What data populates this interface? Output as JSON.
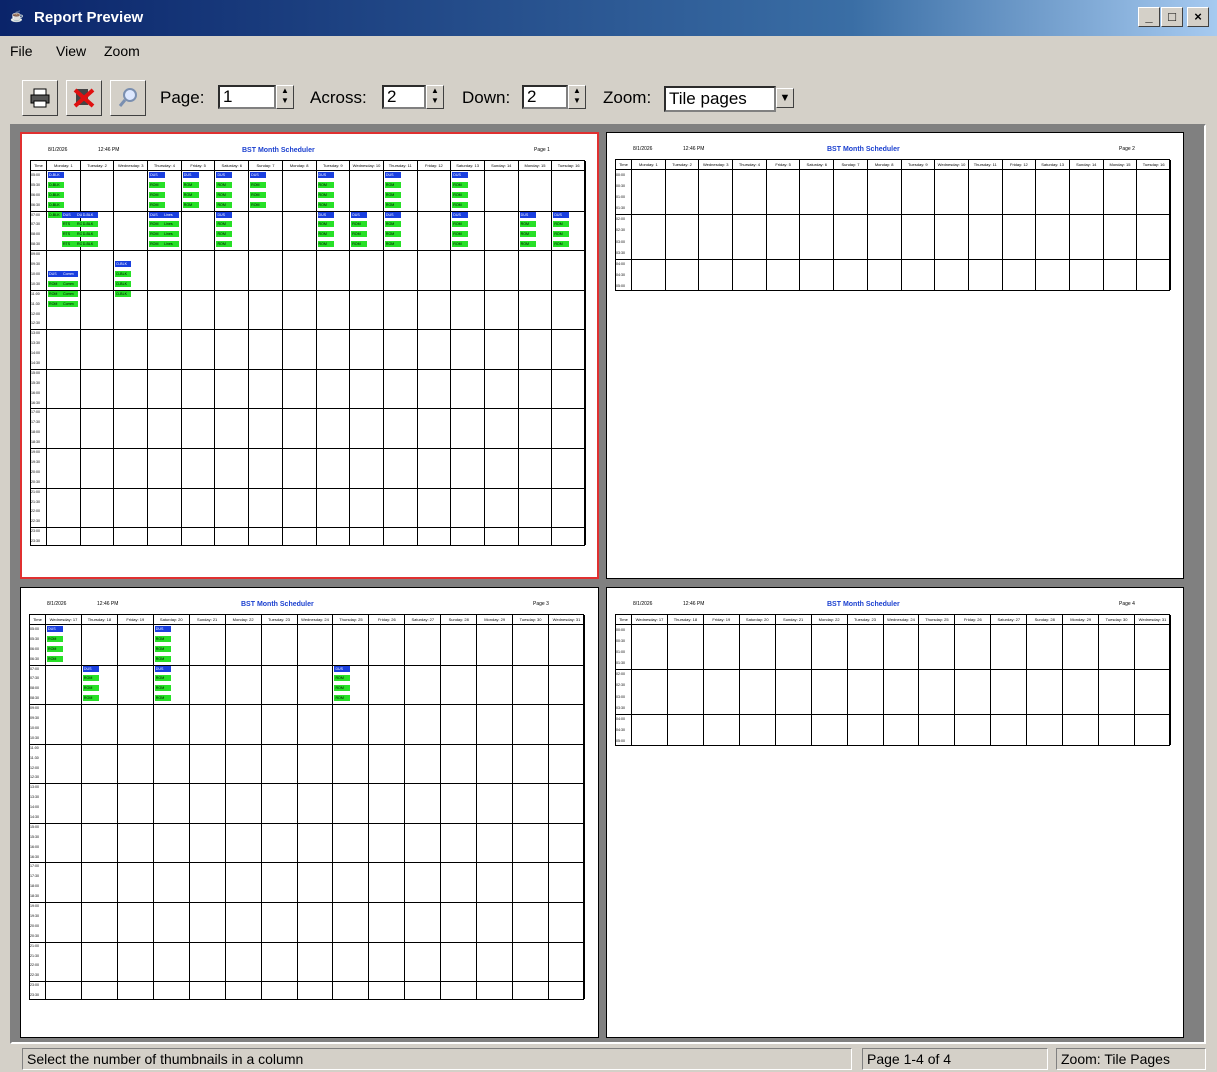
{
  "window": {
    "title": "Report Preview",
    "min_label": "_",
    "max_label": "□",
    "close_label": "×"
  },
  "menu": [
    "File",
    "View",
    "Zoom"
  ],
  "toolbar": {
    "page_label": "Page:",
    "page_value": "1",
    "across_label": "Across:",
    "across_value": "2",
    "down_label": "Down:",
    "down_value": "2",
    "zoom_label": "Zoom:",
    "zoom_value": "Tile pages",
    "icons": [
      "printer-icon",
      "close-x-icon",
      "magnifier-icon"
    ]
  },
  "pages": [
    {
      "date": "8/1/2026",
      "time": "12:46 PM",
      "title": "BST Month Scheduler",
      "page_label": "Page 1",
      "days": [
        "Time",
        "Monday: 1",
        "Tuesday: 2",
        "Wednesday: 3",
        "Thursday: 4",
        "Friday: 5",
        "Saturday: 6",
        "Sunday: 7",
        "Monday: 8",
        "Tuesday: 9",
        "Wednesday: 10",
        "Thursday: 11",
        "Friday: 12",
        "Saturday: 13",
        "Sunday: 14",
        "Monday: 15",
        "Tuesday: 16"
      ],
      "times": [
        "05:00",
        "05:30",
        "06:00",
        "06:30",
        "07:00",
        "07:30",
        "08:00",
        "08:30",
        "09:00",
        "09:30",
        "10:00",
        "10:30",
        "11:00",
        "11:30",
        "12:00",
        "12:30",
        "13:00",
        "13:30",
        "14:00",
        "14:30",
        "15:00",
        "15:30",
        "16:00",
        "16:30",
        "17:00",
        "17:30",
        "18:00",
        "18:30",
        "19:00",
        "19:30",
        "20:00",
        "20:30",
        "21:00",
        "21:30",
        "22:00",
        "22:30",
        "23:00",
        "23:30"
      ],
      "events": [
        {
          "col": 1,
          "row": 0,
          "text": "D-BLK",
          "c": "blue"
        },
        {
          "col": 1,
          "row": 1,
          "text": "D-BLK",
          "c": "green"
        },
        {
          "col": 1,
          "row": 2,
          "text": "D-BLK",
          "c": "green"
        },
        {
          "col": 1,
          "row": 3,
          "text": "D-BLK",
          "c": "green"
        },
        {
          "col": 1,
          "row": 4,
          "text": "D-BLK",
          "c": "green"
        },
        {
          "col": 4,
          "row": 0,
          "text": "DUS",
          "c": "blue"
        },
        {
          "col": 4,
          "row": 1,
          "text": "ROM",
          "c": "green"
        },
        {
          "col": 4,
          "row": 2,
          "text": "ROM",
          "c": "green"
        },
        {
          "col": 4,
          "row": 3,
          "text": "ROM",
          "c": "green"
        },
        {
          "col": 5,
          "row": 0,
          "text": "DUS",
          "c": "blue"
        },
        {
          "col": 5,
          "row": 1,
          "text": "ROM",
          "c": "green"
        },
        {
          "col": 5,
          "row": 2,
          "text": "ROM",
          "c": "green"
        },
        {
          "col": 5,
          "row": 3,
          "text": "ROM",
          "c": "green"
        },
        {
          "col": 6,
          "row": 0,
          "text": "DUS",
          "c": "blue"
        },
        {
          "col": 6,
          "row": 1,
          "text": "ROM",
          "c": "green"
        },
        {
          "col": 6,
          "row": 2,
          "text": "ROM",
          "c": "green"
        },
        {
          "col": 6,
          "row": 3,
          "text": "ROM",
          "c": "green"
        },
        {
          "col": 7,
          "row": 0,
          "text": "DUS",
          "c": "blue"
        },
        {
          "col": 7,
          "row": 1,
          "text": "ROM",
          "c": "green"
        },
        {
          "col": 7,
          "row": 2,
          "text": "ROM",
          "c": "green"
        },
        {
          "col": 7,
          "row": 3,
          "text": "ROM",
          "c": "green"
        },
        {
          "col": 9,
          "row": 0,
          "text": "DUS",
          "c": "blue"
        },
        {
          "col": 9,
          "row": 1,
          "text": "ROM",
          "c": "green"
        },
        {
          "col": 9,
          "row": 2,
          "text": "ROM",
          "c": "green"
        },
        {
          "col": 9,
          "row": 3,
          "text": "ROM",
          "c": "green"
        },
        {
          "col": 11,
          "row": 0,
          "text": "DUS",
          "c": "blue"
        },
        {
          "col": 11,
          "row": 1,
          "text": "ROM",
          "c": "green"
        },
        {
          "col": 11,
          "row": 2,
          "text": "ROM",
          "c": "green"
        },
        {
          "col": 11,
          "row": 3,
          "text": "ROM",
          "c": "green"
        },
        {
          "col": 13,
          "row": 0,
          "text": "DUS",
          "c": "blue"
        },
        {
          "col": 13,
          "row": 1,
          "text": "ROM",
          "c": "green"
        },
        {
          "col": 13,
          "row": 2,
          "text": "ROM",
          "c": "green"
        },
        {
          "col": 13,
          "row": 3,
          "text": "ROM",
          "c": "green"
        },
        {
          "col": 1,
          "row": 4,
          "text": "DUS",
          "c": "blue",
          "x": 14
        },
        {
          "col": 1,
          "row": 4,
          "text": "DUS",
          "c": "blue",
          "x": 28
        },
        {
          "col": 2,
          "row": 4,
          "text": "D-BLK",
          "c": "blue"
        },
        {
          "col": 1,
          "row": 5,
          "text": "RTS",
          "c": "green",
          "x": 14
        },
        {
          "col": 1,
          "row": 5,
          "text": "ROM",
          "c": "green",
          "x": 28
        },
        {
          "col": 2,
          "row": 5,
          "text": "D-BLK",
          "c": "green"
        },
        {
          "col": 1,
          "row": 6,
          "text": "RTS",
          "c": "green",
          "x": 14
        },
        {
          "col": 1,
          "row": 6,
          "text": "ROM",
          "c": "green",
          "x": 28
        },
        {
          "col": 2,
          "row": 6,
          "text": "D-BLK",
          "c": "green"
        },
        {
          "col": 1,
          "row": 7,
          "text": "RTS",
          "c": "green",
          "x": 14
        },
        {
          "col": 1,
          "row": 7,
          "text": "ROM",
          "c": "green",
          "x": 28
        },
        {
          "col": 2,
          "row": 7,
          "text": "D-BLK",
          "c": "green"
        },
        {
          "col": 4,
          "row": 4,
          "text": "DUS",
          "c": "blue"
        },
        {
          "col": 4,
          "row": 5,
          "text": "ROM",
          "c": "green"
        },
        {
          "col": 4,
          "row": 6,
          "text": "ROM",
          "c": "green"
        },
        {
          "col": 4,
          "row": 7,
          "text": "ROM",
          "c": "green"
        },
        {
          "col": 4,
          "row": 4,
          "text": "Lines",
          "c": "blue",
          "x": 14
        },
        {
          "col": 4,
          "row": 5,
          "text": "Lines",
          "c": "green",
          "x": 14
        },
        {
          "col": 4,
          "row": 6,
          "text": "Lines",
          "c": "green",
          "x": 14
        },
        {
          "col": 4,
          "row": 7,
          "text": "Lines",
          "c": "green",
          "x": 14
        },
        {
          "col": 6,
          "row": 4,
          "text": "DUS",
          "c": "blue"
        },
        {
          "col": 6,
          "row": 5,
          "text": "ROM",
          "c": "green"
        },
        {
          "col": 6,
          "row": 6,
          "text": "ROM",
          "c": "green"
        },
        {
          "col": 6,
          "row": 7,
          "text": "ROM",
          "c": "green"
        },
        {
          "col": 9,
          "row": 4,
          "text": "DUS",
          "c": "blue"
        },
        {
          "col": 9,
          "row": 5,
          "text": "ROM",
          "c": "green"
        },
        {
          "col": 9,
          "row": 6,
          "text": "ROM",
          "c": "green"
        },
        {
          "col": 9,
          "row": 7,
          "text": "ROM",
          "c": "green"
        },
        {
          "col": 10,
          "row": 4,
          "text": "DUS",
          "c": "blue"
        },
        {
          "col": 10,
          "row": 5,
          "text": "ROM",
          "c": "green"
        },
        {
          "col": 10,
          "row": 6,
          "text": "ROM",
          "c": "green"
        },
        {
          "col": 10,
          "row": 7,
          "text": "ROM",
          "c": "green"
        },
        {
          "col": 11,
          "row": 4,
          "text": "DUS",
          "c": "blue"
        },
        {
          "col": 11,
          "row": 5,
          "text": "ROM",
          "c": "green"
        },
        {
          "col": 11,
          "row": 6,
          "text": "ROM",
          "c": "green"
        },
        {
          "col": 11,
          "row": 7,
          "text": "ROM",
          "c": "green"
        },
        {
          "col": 13,
          "row": 4,
          "text": "DUS",
          "c": "blue"
        },
        {
          "col": 13,
          "row": 5,
          "text": "ROM",
          "c": "green"
        },
        {
          "col": 13,
          "row": 6,
          "text": "ROM",
          "c": "green"
        },
        {
          "col": 13,
          "row": 7,
          "text": "ROM",
          "c": "green"
        },
        {
          "col": 15,
          "row": 4,
          "text": "DUS",
          "c": "blue"
        },
        {
          "col": 15,
          "row": 5,
          "text": "ROM",
          "c": "green"
        },
        {
          "col": 15,
          "row": 6,
          "text": "ROM",
          "c": "green"
        },
        {
          "col": 15,
          "row": 7,
          "text": "ROM",
          "c": "green"
        },
        {
          "col": 16,
          "row": 4,
          "text": "DUS",
          "c": "blue"
        },
        {
          "col": 16,
          "row": 5,
          "text": "ROM",
          "c": "green"
        },
        {
          "col": 16,
          "row": 6,
          "text": "ROM",
          "c": "green"
        },
        {
          "col": 16,
          "row": 7,
          "text": "ROM",
          "c": "green"
        },
        {
          "col": 3,
          "row": 9,
          "text": "D-BLK",
          "c": "blue"
        },
        {
          "col": 3,
          "row": 10,
          "text": "D-BLK",
          "c": "green"
        },
        {
          "col": 3,
          "row": 11,
          "text": "D-BLK",
          "c": "green"
        },
        {
          "col": 3,
          "row": 12,
          "text": "D-BLK",
          "c": "green"
        },
        {
          "col": 1,
          "row": 10,
          "text": "DUS",
          "c": "blue"
        },
        {
          "col": 1,
          "row": 10,
          "text": "Comm",
          "c": "blue",
          "x": 14
        },
        {
          "col": 1,
          "row": 11,
          "text": "ROM",
          "c": "green"
        },
        {
          "col": 1,
          "row": 11,
          "text": "Comm",
          "c": "green",
          "x": 14
        },
        {
          "col": 1,
          "row": 12,
          "text": "ROM",
          "c": "green"
        },
        {
          "col": 1,
          "row": 12,
          "text": "Comm",
          "c": "green",
          "x": 14
        },
        {
          "col": 1,
          "row": 13,
          "text": "ROM",
          "c": "green"
        },
        {
          "col": 1,
          "row": 13,
          "text": "Comm",
          "c": "green",
          "x": 14
        }
      ]
    },
    {
      "date": "8/1/2026",
      "time": "12:46 PM",
      "title": "BST Month Scheduler",
      "page_label": "Page 2",
      "days": [
        "Time",
        "Monday: 1",
        "Tuesday: 2",
        "Wednesday: 3",
        "Thursday: 4",
        "Friday: 5",
        "Saturday: 6",
        "Sunday: 7",
        "Monday: 8",
        "Tuesday: 9",
        "Wednesday: 10",
        "Thursday: 11",
        "Friday: 12",
        "Saturday: 13",
        "Sunday: 14",
        "Monday: 15",
        "Tuesday: 16"
      ],
      "times": [
        "00:00",
        "00:30",
        "01:00",
        "01:30",
        "02:00",
        "02:30",
        "03:00",
        "03:30",
        "04:00",
        "04:30",
        "05:00"
      ],
      "events": []
    },
    {
      "date": "8/1/2026",
      "time": "12:46 PM",
      "title": "BST Month Scheduler",
      "page_label": "Page 3",
      "days": [
        "Time",
        "Wednesday: 17",
        "Thursday: 18",
        "Friday: 19",
        "Saturday: 20",
        "Sunday: 21",
        "Monday: 22",
        "Tuesday: 23",
        "Wednesday: 24",
        "Thursday: 25",
        "Friday: 26",
        "Saturday: 27",
        "Sunday: 28",
        "Monday: 29",
        "Tuesday: 30",
        "Wednesday: 31"
      ],
      "times": [
        "05:00",
        "05:30",
        "06:00",
        "06:30",
        "07:00",
        "07:30",
        "08:00",
        "08:30",
        "09:00",
        "09:30",
        "10:00",
        "10:30",
        "11:00",
        "11:30",
        "12:00",
        "12:30",
        "13:00",
        "13:30",
        "14:00",
        "14:30",
        "15:00",
        "15:30",
        "16:00",
        "16:30",
        "17:00",
        "17:30",
        "18:00",
        "18:30",
        "19:00",
        "19:30",
        "20:00",
        "20:30",
        "21:00",
        "21:30",
        "22:00",
        "22:30",
        "23:00",
        "23:30"
      ],
      "events": [
        {
          "col": 1,
          "row": 0,
          "text": "DUS",
          "c": "blue"
        },
        {
          "col": 1,
          "row": 1,
          "text": "ROM",
          "c": "green"
        },
        {
          "col": 1,
          "row": 2,
          "text": "ROM",
          "c": "green"
        },
        {
          "col": 1,
          "row": 3,
          "text": "ROM",
          "c": "green"
        },
        {
          "col": 4,
          "row": 0,
          "text": "DUS",
          "c": "blue"
        },
        {
          "col": 4,
          "row": 1,
          "text": "ROM",
          "c": "green"
        },
        {
          "col": 4,
          "row": 2,
          "text": "ROM",
          "c": "green"
        },
        {
          "col": 4,
          "row": 3,
          "text": "ROM",
          "c": "green"
        },
        {
          "col": 2,
          "row": 4,
          "text": "DUS",
          "c": "blue"
        },
        {
          "col": 2,
          "row": 5,
          "text": "ROM",
          "c": "green"
        },
        {
          "col": 2,
          "row": 6,
          "text": "ROM",
          "c": "green"
        },
        {
          "col": 2,
          "row": 7,
          "text": "ROM",
          "c": "green"
        },
        {
          "col": 4,
          "row": 4,
          "text": "DUS",
          "c": "blue"
        },
        {
          "col": 4,
          "row": 5,
          "text": "ROM",
          "c": "green"
        },
        {
          "col": 4,
          "row": 6,
          "text": "ROM",
          "c": "green"
        },
        {
          "col": 4,
          "row": 7,
          "text": "ROM",
          "c": "green"
        },
        {
          "col": 9,
          "row": 4,
          "text": "DUS",
          "c": "blue"
        },
        {
          "col": 9,
          "row": 5,
          "text": "ROM",
          "c": "green"
        },
        {
          "col": 9,
          "row": 6,
          "text": "ROM",
          "c": "green"
        },
        {
          "col": 9,
          "row": 7,
          "text": "ROM",
          "c": "green"
        }
      ]
    },
    {
      "date": "8/1/2026",
      "time": "12:46 PM",
      "title": "BST Month Scheduler",
      "page_label": "Page 4",
      "days": [
        "Time",
        "Wednesday: 17",
        "Thursday: 18",
        "Friday: 19",
        "Saturday: 20",
        "Sunday: 21",
        "Monday: 22",
        "Tuesday: 23",
        "Wednesday: 24",
        "Thursday: 25",
        "Friday: 26",
        "Saturday: 27",
        "Sunday: 28",
        "Monday: 29",
        "Tuesday: 30",
        "Wednesday: 31"
      ],
      "times": [
        "00:00",
        "00:30",
        "01:00",
        "01:30",
        "02:00",
        "02:30",
        "03:00",
        "03:30",
        "04:00",
        "04:30",
        "05:00"
      ],
      "events": []
    }
  ],
  "status": {
    "hint": "Select the number of thumbnails in a column",
    "pages": "Page 1-4 of 4",
    "zoom": "Zoom: Tile Pages"
  }
}
